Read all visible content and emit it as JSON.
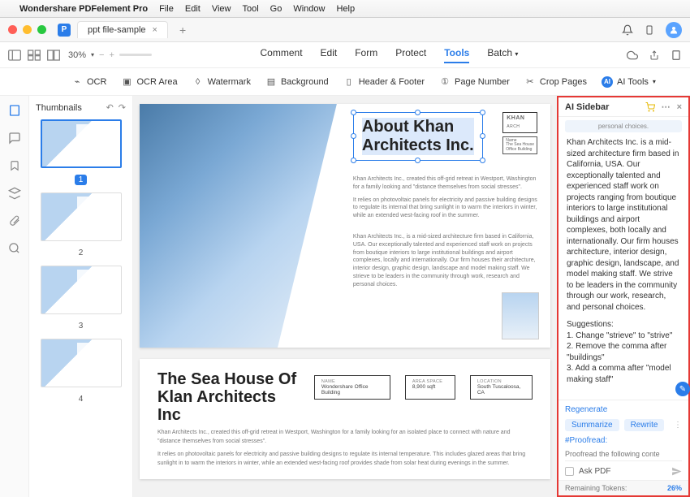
{
  "menubar": {
    "app": "Wondershare PDFelement Pro",
    "items": [
      "File",
      "Edit",
      "View",
      "Tool",
      "Go",
      "Window",
      "Help"
    ]
  },
  "window": {
    "tab_title": "ppt file-sample"
  },
  "toolbar1": {
    "zoom": "30%",
    "tabs": [
      "Comment",
      "Edit",
      "Form",
      "Protect",
      "Tools",
      "Batch"
    ],
    "active_tab": "Tools"
  },
  "toolbar2": {
    "items": [
      {
        "icon": "ocr",
        "label": "OCR"
      },
      {
        "icon": "ocr-area",
        "label": "OCR Area"
      },
      {
        "icon": "watermark",
        "label": "Watermark"
      },
      {
        "icon": "background",
        "label": "Background"
      },
      {
        "icon": "header-footer",
        "label": "Header & Footer"
      },
      {
        "icon": "page-number",
        "label": "Page Number"
      },
      {
        "icon": "crop",
        "label": "Crop Pages"
      },
      {
        "icon": "ai",
        "label": "AI Tools"
      }
    ]
  },
  "thumbnails": {
    "title": "Thumbnails",
    "pages": [
      "1",
      "2",
      "3",
      "4"
    ],
    "selected": 1
  },
  "document": {
    "title_line1": "About Khan",
    "title_line2": "Architects Inc.",
    "logo": "KHAN",
    "logo_sub": "ARCH",
    "para1": "Khan Architects Inc., created this off-grid retreat in Westport, Washington for a family looking and \"distance themselves from social stresses\".",
    "para2": "It relies on photovoltaic panels for electricity and passive building designs to regulate its internal that bring sunlight in to warm the interiors in winter, while an extended west-facing roof in the summer.",
    "para3": "Khan Architects Inc., is a mid-sized architecture firm based in California, USA. Our exceptionally talented and experienced staff work on projects from boutique interiors to large institutional buildings and airport complexes, locally and internationally. Our firm houses their architecture, interior design, graphic design, landscape and model making staff. We strieve to be leaders in the community through work, research and personal choices.",
    "page2_title1": "The Sea House Of",
    "page2_title2": "Klan Architects Inc",
    "info_name_label": "Name",
    "info_name_value": "Wondershare Office Building",
    "info_area_label": "Area Space",
    "info_area_value": "8,900 sqft",
    "info_loc_label": "Location",
    "info_loc_value": "South Tuscaloosa, CA",
    "p2_body1": "Khan Architects Inc., created this off-grid retreat in Westport, Washington for a family looking for an isolated place to connect with nature and \"distance themselves from social stresses\".",
    "p2_body2": "It relies on photovoltaic panels for electricity and passive building designs to regulate its internal temperature. This includes glazed areas that bring sunlight in to warm the interiors in winter, while an extended west-facing roof provides shade from solar heat during evenings in the summer."
  },
  "ai": {
    "title": "AI Sidebar",
    "chip": "personal choices.",
    "response": "Khan Architects Inc. is a mid-sized architecture firm based in California, USA. Our exceptionally talented and experienced staff work on projects ranging from boutique interiors to large institutional buildings and airport complexes, both locally and internationally. Our firm houses architecture, interior design, graphic design, landscape, and model making staff. We strive to be leaders in the community through our work, research, and personal choices.",
    "suggestions_title": "Suggestions:",
    "sug1": "1. Change \"strieve\" to \"strive\"",
    "sug2": "2. Remove the comma after \"buildings\"",
    "sug3": "3. Add a comma after \"model making staff\"",
    "regenerate": "Regenerate",
    "chip_summarize": "Summarize",
    "chip_rewrite": "Rewrite",
    "proofread_label": "#Proofread:",
    "prompt_placeholder": "Proofread the following conte",
    "ask_pdf": "Ask PDF",
    "tokens_label": "Remaining Tokens:",
    "tokens_value": "26%"
  }
}
